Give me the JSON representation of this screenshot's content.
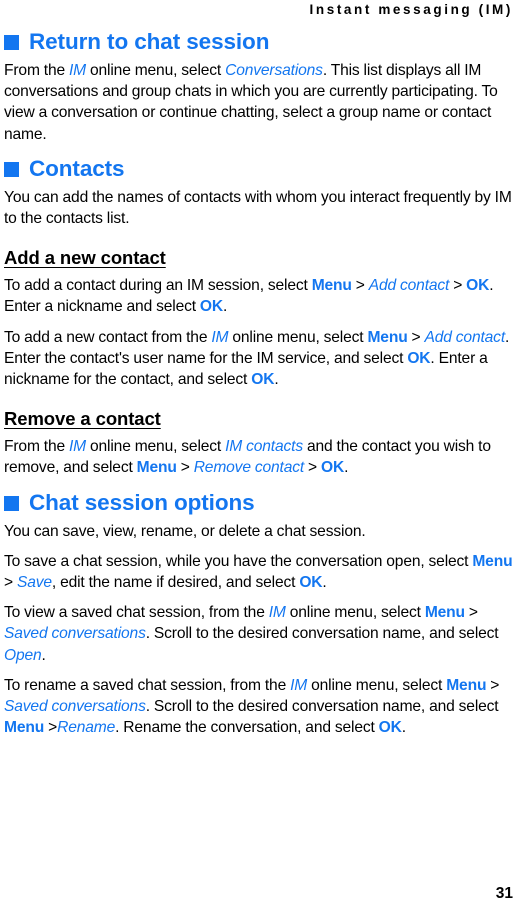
{
  "document": {
    "running_header": "Instant messaging (IM)",
    "page_number": "31",
    "accent_color": "#1376f0",
    "text_color": "#000000",
    "background_color": "#ffffff"
  },
  "sections": [
    {
      "id": "return-to-chat-session",
      "heading": "Return to chat session",
      "heading_bullet": "square-bullet",
      "paragraphs": [
        {
          "runs": [
            {
              "t": "From the ",
              "s": "plain"
            },
            {
              "t": "IM",
              "s": "italic-blue"
            },
            {
              "t": " online menu, select ",
              "s": "plain"
            },
            {
              "t": "Conversations",
              "s": "italic-blue"
            },
            {
              "t": ". This list displays all IM conversations and group chats in which you are currently participating. To view a conversation or continue chatting, select a group name or contact name.",
              "s": "plain"
            }
          ]
        }
      ]
    },
    {
      "id": "contacts",
      "heading": "Contacts",
      "heading_bullet": "square-bullet",
      "paragraphs": [
        {
          "runs": [
            {
              "t": "You can add the names of contacts with whom you interact frequently by IM to the contacts list.",
              "s": "plain"
            }
          ]
        }
      ],
      "subsections": [
        {
          "id": "add-a-new-contact",
          "heading": "Add a new contact",
          "paragraphs": [
            {
              "runs": [
                {
                  "t": "To add a contact during an IM session, select ",
                  "s": "plain"
                },
                {
                  "t": "Menu",
                  "s": "bold-blue"
                },
                {
                  "t": " > ",
                  "s": "plain"
                },
                {
                  "t": "Add contact",
                  "s": "italic-blue"
                },
                {
                  "t": " > ",
                  "s": "plain"
                },
                {
                  "t": "OK",
                  "s": "bold-blue"
                },
                {
                  "t": ". Enter a nickname and select ",
                  "s": "plain"
                },
                {
                  "t": "OK",
                  "s": "bold-blue"
                },
                {
                  "t": ".",
                  "s": "plain"
                }
              ]
            },
            {
              "runs": [
                {
                  "t": "To add a new contact from the ",
                  "s": "plain"
                },
                {
                  "t": "IM",
                  "s": "italic-blue"
                },
                {
                  "t": " online menu, select ",
                  "s": "plain"
                },
                {
                  "t": "Menu",
                  "s": "bold-blue"
                },
                {
                  "t": " > ",
                  "s": "plain"
                },
                {
                  "t": "Add contact",
                  "s": "italic-blue"
                },
                {
                  "t": ". Enter the contact's user name for the IM service, and select ",
                  "s": "plain"
                },
                {
                  "t": "OK",
                  "s": "bold-blue"
                },
                {
                  "t": ". Enter a nickname for the contact, and select ",
                  "s": "plain"
                },
                {
                  "t": "OK",
                  "s": "bold-blue"
                },
                {
                  "t": ".",
                  "s": "plain"
                }
              ]
            }
          ]
        },
        {
          "id": "remove-a-contact",
          "heading": "Remove a contact",
          "paragraphs": [
            {
              "runs": [
                {
                  "t": "From the ",
                  "s": "plain"
                },
                {
                  "t": "IM",
                  "s": "italic-blue"
                },
                {
                  "t": " online menu, select ",
                  "s": "plain"
                },
                {
                  "t": "IM contacts",
                  "s": "italic-blue"
                },
                {
                  "t": " and the contact you wish to remove, and select ",
                  "s": "plain"
                },
                {
                  "t": "Menu",
                  "s": "bold-blue"
                },
                {
                  "t": " > ",
                  "s": "plain"
                },
                {
                  "t": "Remove contact",
                  "s": "italic-blue"
                },
                {
                  "t": " > ",
                  "s": "plain"
                },
                {
                  "t": "OK",
                  "s": "bold-blue"
                },
                {
                  "t": ".",
                  "s": "plain"
                }
              ]
            }
          ]
        }
      ]
    },
    {
      "id": "chat-session-options",
      "heading": "Chat session options",
      "heading_bullet": "square-bullet",
      "paragraphs": [
        {
          "runs": [
            {
              "t": "You can save, view, rename, or delete a chat session.",
              "s": "plain"
            }
          ]
        },
        {
          "runs": [
            {
              "t": "To save a chat session, while you have the conversation open, select ",
              "s": "plain"
            },
            {
              "t": "Menu",
              "s": "bold-blue"
            },
            {
              "t": " > ",
              "s": "plain"
            },
            {
              "t": "Save",
              "s": "italic-blue"
            },
            {
              "t": ", edit the name if desired, and select ",
              "s": "plain"
            },
            {
              "t": "OK",
              "s": "bold-blue"
            },
            {
              "t": ".",
              "s": "plain"
            }
          ]
        },
        {
          "runs": [
            {
              "t": "To view a saved chat session, from the ",
              "s": "plain"
            },
            {
              "t": "IM",
              "s": "italic-blue"
            },
            {
              "t": " online menu, select ",
              "s": "plain"
            },
            {
              "t": "Menu",
              "s": "bold-blue"
            },
            {
              "t": " > ",
              "s": "plain"
            },
            {
              "t": "Saved conversations",
              "s": "italic-blue"
            },
            {
              "t": ". Scroll to the desired conversation name, and select ",
              "s": "plain"
            },
            {
              "t": "Open",
              "s": "italic-blue"
            },
            {
              "t": ".",
              "s": "plain"
            }
          ]
        },
        {
          "runs": [
            {
              "t": "To rename a saved chat session, from the ",
              "s": "plain"
            },
            {
              "t": "IM",
              "s": "italic-blue"
            },
            {
              "t": " online menu, select ",
              "s": "plain"
            },
            {
              "t": "Menu",
              "s": "bold-blue"
            },
            {
              "t": " > ",
              "s": "plain"
            },
            {
              "t": "Saved conversations",
              "s": "italic-blue"
            },
            {
              "t": ". Scroll to the desired conversation name, and select ",
              "s": "plain"
            },
            {
              "t": "Menu",
              "s": "bold-blue"
            },
            {
              "t": " >",
              "s": "plain"
            },
            {
              "t": "Rename",
              "s": "italic-blue"
            },
            {
              "t": ". Rename the conversation, and select ",
              "s": "plain"
            },
            {
              "t": "OK",
              "s": "bold-blue"
            },
            {
              "t": ".",
              "s": "plain"
            }
          ]
        }
      ]
    }
  ]
}
